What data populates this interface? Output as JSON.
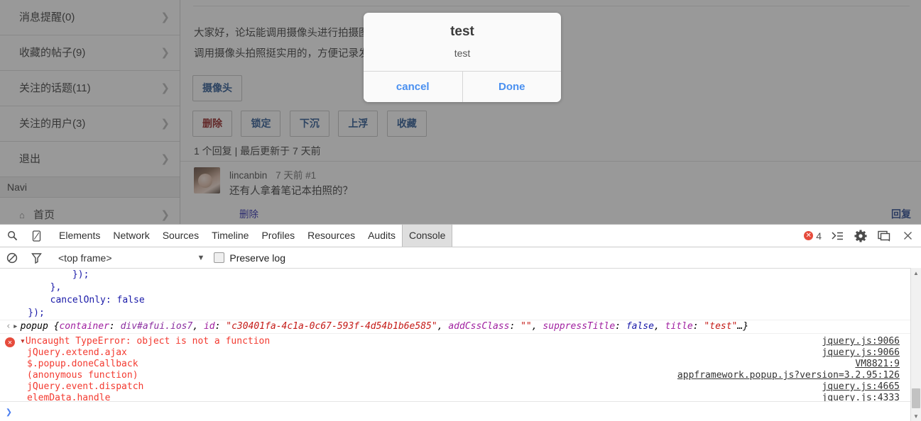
{
  "webpage": {
    "sidebar": {
      "items": [
        {
          "label": "消息提醒(0)",
          "chevron": "chevron-right-icon"
        },
        {
          "label": "收藏的帖子(9)",
          "chevron": "chevron-right-icon"
        },
        {
          "label": "关注的话题(11)",
          "chevron": "chevron-right-icon"
        },
        {
          "label": "关注的用户(3)",
          "chevron": "chevron-right-icon"
        },
        {
          "label": "退出",
          "chevron": "chevron-right-icon"
        }
      ],
      "nav_header": "Navi",
      "nav_items": [
        {
          "label": "首页",
          "icon": "home-icon",
          "chevron": "chevron-right-icon"
        }
      ]
    },
    "post": {
      "body_lines": [
        "大家好，论坛能调用摄像头进行拍摄图",
        "调用摄像头拍照挺实用的，方便记录发"
      ],
      "camera_button": "摄像头",
      "action_buttons": [
        {
          "label": "删除",
          "color": "#8c1414"
        },
        {
          "label": "锁定",
          "color": "#1f4e8c"
        },
        {
          "label": "下沉",
          "color": "#1f4e8c"
        },
        {
          "label": "上浮",
          "color": "#1f4e8c"
        },
        {
          "label": "收藏",
          "color": "#1f4e8c"
        }
      ],
      "reply_summary": "1 个回复 | 最后更新于 7 天前",
      "reply": {
        "username": "lincanbin",
        "time": "7 天前 #1",
        "text": "还有人拿着笔记本拍照的？",
        "delete_label": "删除"
      },
      "reply_link": "回复"
    }
  },
  "modal": {
    "title": "test",
    "message": "test",
    "cancel_label": "cancel",
    "done_label": "Done",
    "accent": "#4a90f0"
  },
  "devtools": {
    "left_icons": [
      {
        "name": "search-icon",
        "glyph": "⌕"
      },
      {
        "name": "device-toolbar-icon",
        "glyph": "▯"
      }
    ],
    "tabs": [
      {
        "label": "Elements",
        "active": false
      },
      {
        "label": "Network",
        "active": false
      },
      {
        "label": "Sources",
        "active": false
      },
      {
        "label": "Timeline",
        "active": false
      },
      {
        "label": "Profiles",
        "active": false
      },
      {
        "label": "Resources",
        "active": false
      },
      {
        "label": "Audits",
        "active": false
      },
      {
        "label": "Console",
        "active": true
      }
    ],
    "error_count": "4",
    "right_icons": [
      {
        "name": "console-drawer-icon",
        "glyph": "≫"
      },
      {
        "name": "settings-gear-icon",
        "glyph": "✱"
      },
      {
        "name": "dock-side-icon",
        "glyph": "▣"
      },
      {
        "name": "close-devtools-icon",
        "glyph": "×"
      }
    ],
    "filterbar": {
      "clear_icon": "clear-console-icon",
      "filter_icon": "filter-funnel-icon",
      "frame": "<top frame>",
      "dropdown_icon": "chevron-down-icon",
      "preserve_log": "Preserve log",
      "preserve_log_checked": false
    },
    "console": {
      "code_lines": [
        "            });",
        "        },",
        "        cancelOnly: false",
        "    });"
      ],
      "object_line": {
        "name": "popup",
        "props": [
          {
            "key": "container",
            "value": "div#afui.ios7",
            "type": "dom"
          },
          {
            "key": "id",
            "value": "\"c30401fa-4c1a-0c67-593f-4d54b1b6e585\"",
            "type": "string"
          },
          {
            "key": "addCssClass",
            "value": "\"\"",
            "type": "string"
          },
          {
            "key": "suppressTitle",
            "value": "false",
            "type": "bool"
          },
          {
            "key": "title",
            "value": "\"test\"",
            "type": "string"
          }
        ],
        "ellipsis": "…}"
      },
      "error": {
        "title": "Uncaught TypeError: object is not a function",
        "title_source": "jquery.js:9066",
        "frames": [
          {
            "fn": "jQuery.extend.ajax",
            "src": "jquery.js:9066"
          },
          {
            "fn": "$.popup.doneCallback",
            "src": "VM8821:9"
          },
          {
            "fn": "(anonymous function)",
            "src": "appframework.popup.js?version=3.2.95:126"
          },
          {
            "fn": "jQuery.event.dispatch",
            "src": "jquery.js:4665"
          },
          {
            "fn": "elemData.handle",
            "src": "jquery.js:4333"
          }
        ]
      },
      "prompt_glyph": "❯"
    }
  }
}
